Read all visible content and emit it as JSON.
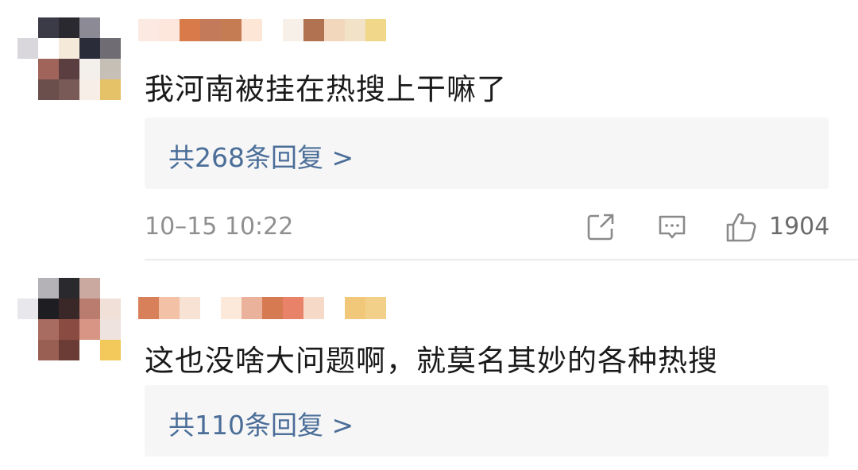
{
  "comments": [
    {
      "text": "我河南被挂在热搜上干嘛了",
      "reply_link": "共268条回复 >",
      "timestamp": "10–15 10:22",
      "likes": "1904",
      "avatar_colors": [
        "#ffffff",
        "#3b3a47",
        "#2a2930",
        "#8c8a94",
        "#ffffff",
        "#d9d7dc",
        "#ffffff",
        "#f5e9d9",
        "#2b2c3a",
        "#6f6c73",
        "#ffffff",
        "#a1645a",
        "#5a3e40",
        "#f3f0ec",
        "#c6bfb5",
        "#ffffff",
        "#6a4f4c",
        "#7a5a56",
        "#f7efe7",
        "#e5c168"
      ],
      "username_colors": [
        "#fce9e2",
        "#fde7dc",
        "#d97a4a",
        "#c27a5a",
        "#c57c52",
        "#fde6d5",
        "#ffffff",
        "#f7f0e8",
        "#b07251",
        "#f3d7bd",
        "#f1e2c8",
        "#f0d78a"
      ]
    },
    {
      "text": "这也没啥大问题啊，就莫名其妙的各种热搜",
      "reply_link": "共110条回复 >",
      "avatar_colors": [
        "#ffffff",
        "#b4b2b6",
        "#2a2a2e",
        "#c9a9a0",
        "#ffffff",
        "#e8e8ec",
        "#1e1e22",
        "#3a2828",
        "#b97c6e",
        "#f0e0d8",
        "#ffffff",
        "#a86c60",
        "#8a4c42",
        "#d89484",
        "#efe3df",
        "#ffffff",
        "#9a5f53",
        "#6a3c35",
        "#ffffff",
        "#f2c95a"
      ],
      "username_colors": [
        "#d8805a",
        "#f3c1a6",
        "#f7e2d3",
        "#ffffff",
        "#fde9d9",
        "#eab19b",
        "#d67a52",
        "#e8836a",
        "#f7d9c8",
        "#ffffff",
        "#f1c87a",
        "#f3d08a"
      ]
    }
  ],
  "icons": {
    "share": "share-icon",
    "reply": "comment-icon",
    "like": "thumbs-up-icon"
  },
  "colors": {
    "link": "#4b6e99",
    "reply_box_bg": "#f6f6f6",
    "text": "#1a1a1a",
    "meta": "#8f8f8f"
  }
}
